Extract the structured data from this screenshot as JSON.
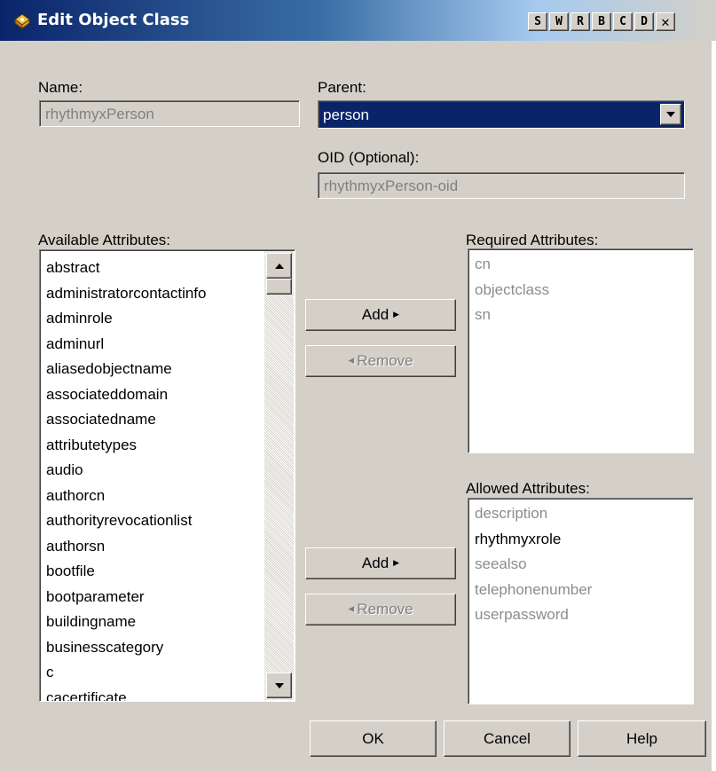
{
  "window": {
    "title": "Edit Object Class",
    "title_buttons": [
      "S",
      "W",
      "R",
      "B",
      "C",
      "D",
      "✕"
    ],
    "icons": {
      "app": "object-class-icon",
      "close": "close-icon",
      "combo_arrow": "chevron-down-icon"
    }
  },
  "form": {
    "name_label": "Name:",
    "name_value": "rhythmyxPerson",
    "parent_label": "Parent:",
    "parent_value": "person",
    "oid_label": "OID (Optional):",
    "oid_value": "rhythmyxPerson-oid"
  },
  "available": {
    "label": "Available Attributes:",
    "items": [
      "abstract",
      "administratorcontactinfo",
      "adminrole",
      "adminurl",
      "aliasedobjectname",
      "associateddomain",
      "associatedname",
      "attributetypes",
      "audio",
      "authorcn",
      "authorityrevocationlist",
      "authorsn",
      "bootfile",
      "bootparameter",
      "buildingname",
      "businesscategory",
      "c",
      "cacertificate"
    ]
  },
  "required": {
    "label": "Required Attributes:",
    "items": [
      "cn",
      "objectclass",
      "sn"
    ],
    "add_label": "Add",
    "remove_label": "Remove"
  },
  "allowed": {
    "label": "Allowed Attributes:",
    "items": [
      "description",
      "rhythmyxrole",
      "seealso",
      "telephonenumber",
      "userpassword"
    ],
    "highlight": "rhythmyxrole",
    "add_label": "Add",
    "remove_label": "Remove"
  },
  "footer": {
    "ok_label": "OK",
    "cancel_label": "Cancel",
    "help_label": "Help"
  },
  "colors": {
    "dialog_bg": "#d4d0c8",
    "title_active": "#0a246a",
    "selection": "#0a246a",
    "disabled_text": "#808080"
  }
}
